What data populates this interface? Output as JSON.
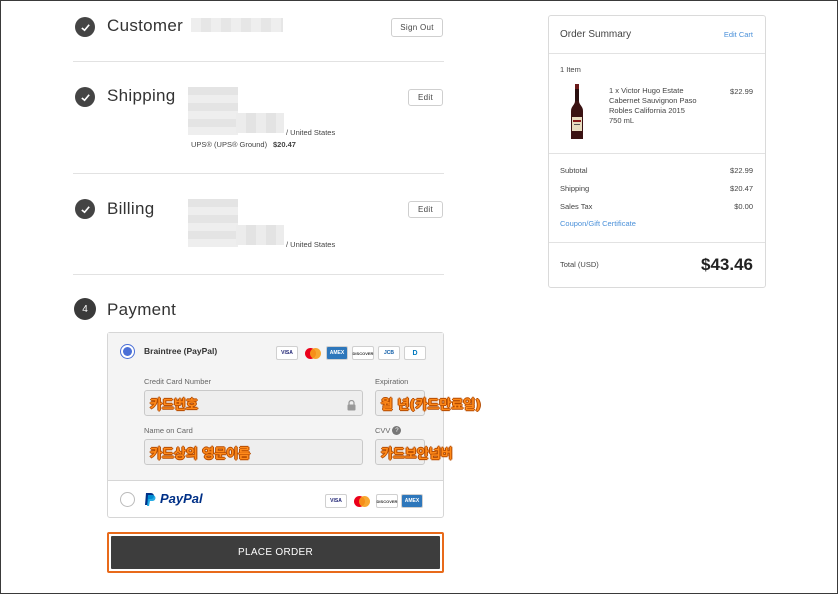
{
  "customer": {
    "title": "Customer",
    "sign_out_label": "Sign Out"
  },
  "shipping": {
    "title": "Shipping",
    "edit_label": "Edit",
    "country": "/ United States",
    "method": "UPS® (UPS® Ground)",
    "cost": "$20.47"
  },
  "billing": {
    "title": "Billing",
    "edit_label": "Edit",
    "country": "/ United States"
  },
  "payment": {
    "step_number": "4",
    "title": "Payment",
    "braintree_label": "Braintree (PayPal)",
    "card_number_label": "Credit Card Number",
    "card_number_value": "카드번호",
    "expiration_label": "Expiration",
    "expiration_value": "월 년(카드만료일)",
    "name_label": "Name on Card",
    "name_value": "카드상의 영문이름",
    "cvv_label": "CVV",
    "cvv_value": "카드보안넘버",
    "paypal_label": "PayPal",
    "cards": {
      "visa": "VISA",
      "amex": "AMEX",
      "discover": "DISCOVER",
      "jcb": "JCB",
      "diners": "D"
    },
    "place_order_label": "PLACE ORDER"
  },
  "summary": {
    "title": "Order Summary",
    "edit_cart_label": "Edit Cart",
    "item_count": "1 Item",
    "item_desc_1": "1 x Victor Hugo Estate",
    "item_desc_2": "Cabernet Sauvignon Paso",
    "item_desc_3": "Robles California 2015",
    "item_desc_4": "750 mL",
    "item_price": "$22.99",
    "subtotal_label": "Subtotal",
    "subtotal_value": "$22.99",
    "shipping_label": "Shipping",
    "shipping_value": "$20.47",
    "tax_label": "Sales Tax",
    "tax_value": "$0.00",
    "coupon_label": "Coupon/Gift Certificate",
    "total_label": "Total (USD)",
    "total_value": "$43.46"
  },
  "colors": {
    "accent_blue": "#4a6fd6",
    "link_blue": "#4a90d9",
    "highlight_orange": "#e86a1a",
    "button_dark": "#3d3d3d"
  }
}
